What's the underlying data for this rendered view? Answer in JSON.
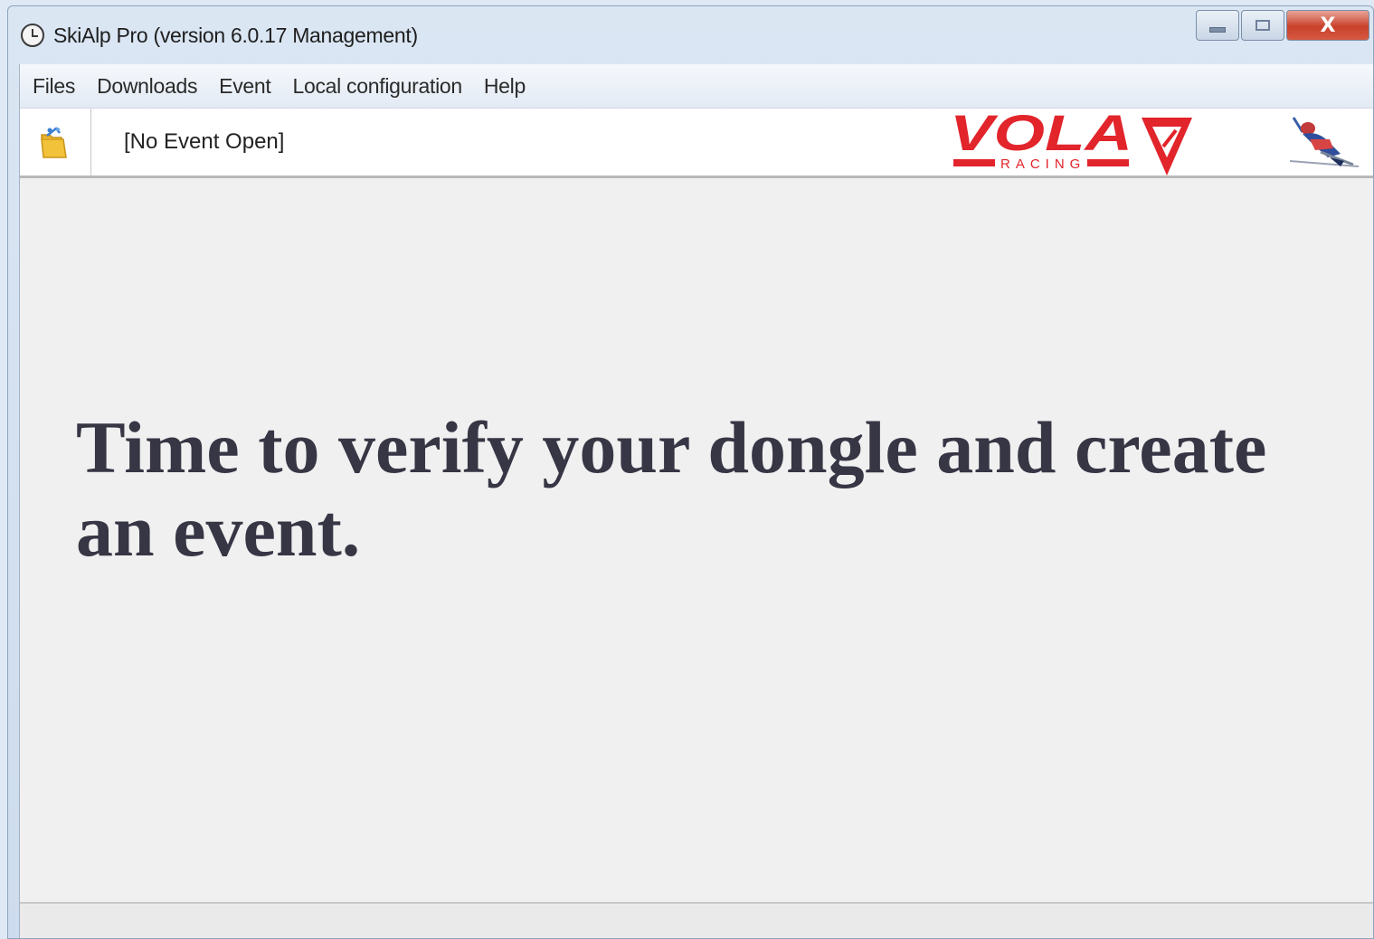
{
  "window": {
    "title": "SkiAlp Pro (version 6.0.17 Management)",
    "close_glyph": "X"
  },
  "menu": {
    "items": [
      {
        "label": "Files"
      },
      {
        "label": "Downloads"
      },
      {
        "label": "Event"
      },
      {
        "label": "Local configuration"
      },
      {
        "label": "Help"
      }
    ]
  },
  "toolbar": {
    "event_status": "[No Event Open]",
    "logo_text": "VOLA",
    "logo_subtext": "RACING"
  },
  "main": {
    "message": "Time to verify your dongle and create an event."
  },
  "colors": {
    "brand_red": "#e2242b",
    "text_dark": "#373645"
  },
  "icons": {
    "app": "clock-icon",
    "open_event": "open-folder-icon",
    "skier": "skier-logo-icon"
  }
}
